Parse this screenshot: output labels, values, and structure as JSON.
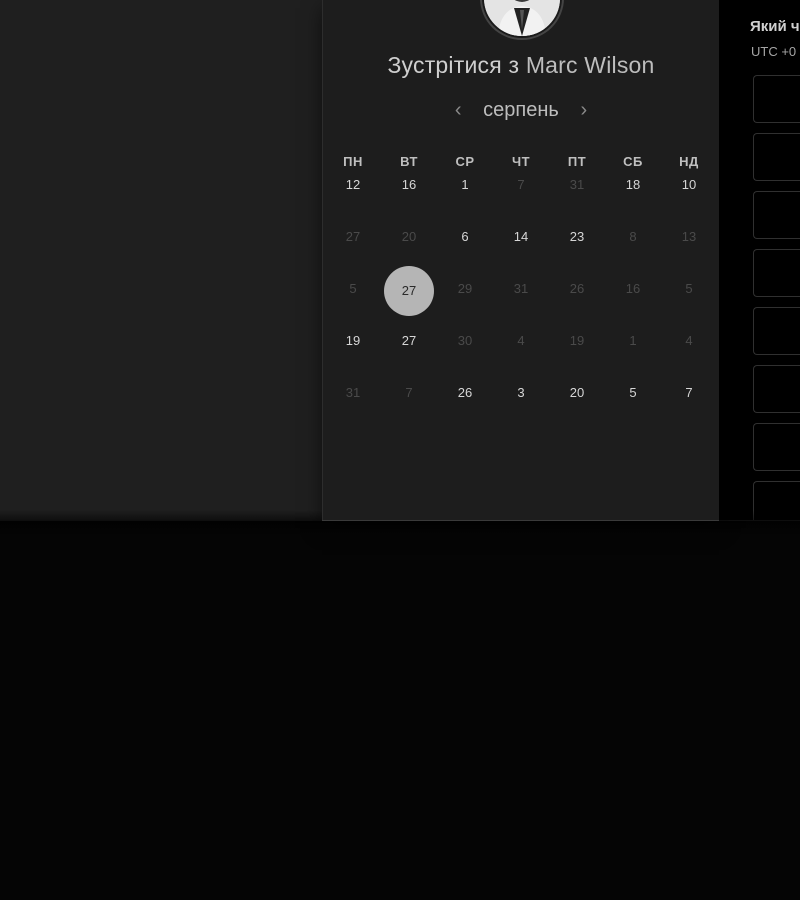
{
  "meeting": {
    "title_prefix": "Зустрітися з ",
    "host_name": "Marc Wilson"
  },
  "calendar": {
    "month": "серпень",
    "prev_arrow": "‹",
    "next_arrow": "›",
    "weekdays": [
      "ПН",
      "ВТ",
      "СР",
      "ЧТ",
      "ПТ",
      "СБ",
      "НД"
    ],
    "days": [
      {
        "label": "12",
        "state": "active"
      },
      {
        "label": "16",
        "state": "active"
      },
      {
        "label": "1",
        "state": "active"
      },
      {
        "label": "7",
        "state": "muted"
      },
      {
        "label": "31",
        "state": "muted"
      },
      {
        "label": "18",
        "state": "active"
      },
      {
        "label": "10",
        "state": "active"
      },
      {
        "label": "27",
        "state": "muted"
      },
      {
        "label": "20",
        "state": "muted"
      },
      {
        "label": "6",
        "state": "active"
      },
      {
        "label": "14",
        "state": "active"
      },
      {
        "label": "23",
        "state": "active"
      },
      {
        "label": "8",
        "state": "muted"
      },
      {
        "label": "13",
        "state": "muted"
      },
      {
        "label": "5",
        "state": "muted"
      },
      {
        "label": "27",
        "state": "selected"
      },
      {
        "label": "29",
        "state": "muted"
      },
      {
        "label": "31",
        "state": "muted"
      },
      {
        "label": "26",
        "state": "muted"
      },
      {
        "label": "16",
        "state": "muted"
      },
      {
        "label": "5",
        "state": "muted"
      },
      {
        "label": "19",
        "state": "active"
      },
      {
        "label": "27",
        "state": "active"
      },
      {
        "label": "30",
        "state": "muted"
      },
      {
        "label": "4",
        "state": "muted"
      },
      {
        "label": "19",
        "state": "muted"
      },
      {
        "label": "1",
        "state": "muted"
      },
      {
        "label": "4",
        "state": "muted"
      },
      {
        "label": "31",
        "state": "muted"
      },
      {
        "label": "7",
        "state": "muted"
      },
      {
        "label": "26",
        "state": "active"
      },
      {
        "label": "3",
        "state": "active"
      },
      {
        "label": "20",
        "state": "active"
      },
      {
        "label": "5",
        "state": "active"
      },
      {
        "label": "7",
        "state": "active"
      }
    ]
  },
  "time_panel": {
    "title": "Який ч",
    "timezone": "UTC +0",
    "slots": [
      "",
      "",
      "",
      "",
      "",
      "",
      "",
      ""
    ]
  },
  "colors": {
    "page_bg": "#050505",
    "panel_bg": "#1f1f1f",
    "card_bg": "#1d1d1d",
    "selected_day": "#b5b5b5",
    "muted_text": "#4a4a4a"
  },
  "icons": {
    "avatar": "person-photo",
    "prev": "chevron-left-icon",
    "next": "chevron-right-icon"
  }
}
